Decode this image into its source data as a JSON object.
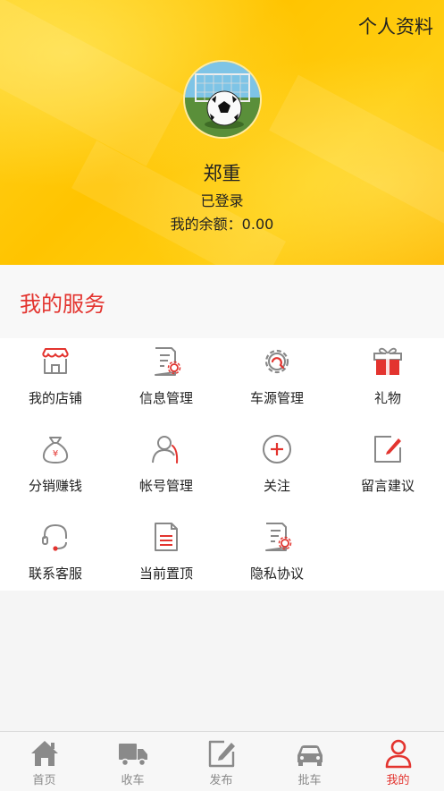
{
  "header": {
    "profile_link": "个人资料",
    "username": "郑重",
    "status": "已登录",
    "balance": "我的余额：0.00"
  },
  "services": {
    "title": "我的服务",
    "items": [
      {
        "label": "我的店铺",
        "icon": "store-icon"
      },
      {
        "label": "信息管理",
        "icon": "document-settings-icon"
      },
      {
        "label": "车源管理",
        "icon": "gear-icon"
      },
      {
        "label": "礼物",
        "icon": "gift-icon"
      },
      {
        "label": "分销赚钱",
        "icon": "money-bag-icon"
      },
      {
        "label": "帐号管理",
        "icon": "user-icon"
      },
      {
        "label": "关注",
        "icon": "plus-circle-icon"
      },
      {
        "label": "留言建议",
        "icon": "edit-icon"
      },
      {
        "label": "联系客服",
        "icon": "headset-icon"
      },
      {
        "label": "当前置顶",
        "icon": "document-icon"
      },
      {
        "label": "隐私协议",
        "icon": "document-settings-icon"
      }
    ]
  },
  "tabbar": {
    "items": [
      {
        "label": "首页",
        "icon": "home-icon",
        "active": false
      },
      {
        "label": "收车",
        "icon": "truck-icon",
        "active": false
      },
      {
        "label": "发布",
        "icon": "edit-icon",
        "active": false
      },
      {
        "label": "批车",
        "icon": "car-icon",
        "active": false
      },
      {
        "label": "我的",
        "icon": "person-icon",
        "active": true
      }
    ]
  },
  "colors": {
    "accent": "#e3342f",
    "hero_yellow": "#ffc400",
    "icon_gray": "#8a8a8a"
  }
}
